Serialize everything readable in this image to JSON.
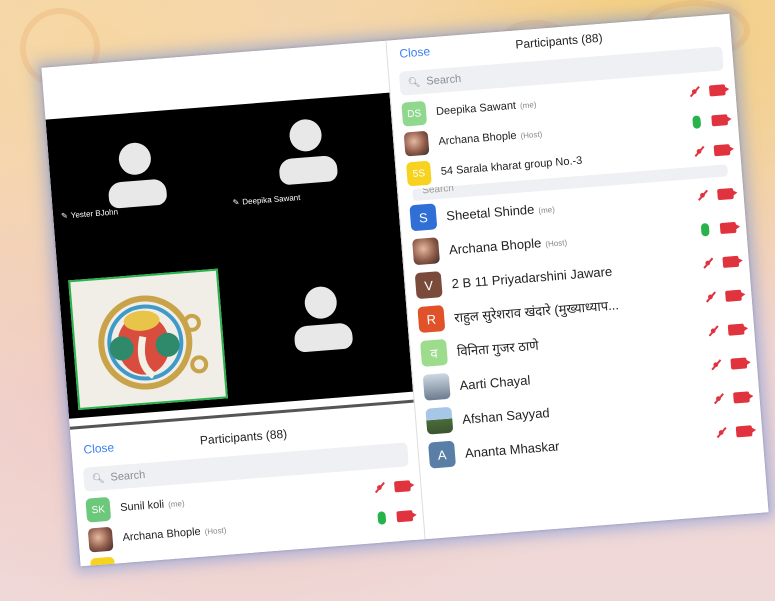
{
  "colors": {
    "accent_blue": "#3b82f6",
    "mic_off_red": "#e0333d",
    "mic_on_green": "#27b34a",
    "video_bg": "#000000",
    "active_speaker": "#2bb24c"
  },
  "video": {
    "tiles": [
      {
        "name": "Yester BJohn",
        "type": "avatar"
      },
      {
        "name": "Deepika Sawant",
        "type": "avatar"
      },
      {
        "name": "",
        "type": "ganesha-image"
      },
      {
        "name": "",
        "type": "avatar"
      }
    ]
  },
  "left_panel": {
    "close_label": "Close",
    "title": "Participants (88)",
    "search_placeholder": "Search",
    "participants": [
      {
        "initials": "SK",
        "name": "Sunil koli",
        "tag": "(me)",
        "badge_color": "#6cc87a",
        "mic": "off"
      },
      {
        "initials": "",
        "name": "Archana Bhople",
        "tag": "(Host)",
        "badge_color": "photo",
        "mic": "on"
      },
      {
        "initials": "5S",
        "name": "54 Sarala kharat group No.-3",
        "tag": "",
        "badge_color": "#f7d21f",
        "mic": "off"
      }
    ]
  },
  "right_panel": {
    "close_label": "Close",
    "title": "Participants (88)",
    "search_placeholder": "Search",
    "sub_search": "Search",
    "top_participants": [
      {
        "initials": "DS",
        "name": "Deepika Sawant",
        "tag": "(me)",
        "badge_color": "#8fd88e",
        "mic": "off"
      },
      {
        "initials": "",
        "name": "Archana Bhople",
        "tag": "(Host)",
        "badge_color": "photo",
        "mic": "on"
      },
      {
        "initials": "5S",
        "name": "54 Sarala kharat group No.-3",
        "tag": "",
        "badge_color": "#f7d21f",
        "mic": "off"
      }
    ],
    "participants": [
      {
        "initials": "S",
        "name": "Sheetal Shinde",
        "tag": "(me)",
        "badge_color": "#2f6fd6",
        "mic": "off"
      },
      {
        "initials": "",
        "name": "Archana Bhople",
        "tag": "(Host)",
        "badge_color": "photo",
        "mic": "on"
      },
      {
        "initials": "V",
        "name": "2 B 11 Priyadarshini Jaware",
        "tag": "",
        "badge_color": "#7a4a3a",
        "mic": "off"
      },
      {
        "initials": "R",
        "name": "राहुल सुरेशराव खंदारे (मुख्याध्याप...",
        "tag": "",
        "badge_color": "#e0522a",
        "mic": "off"
      },
      {
        "initials": "व",
        "name": "विनिता गुजर ठाणे",
        "tag": "",
        "badge_color": "#9ddc8c",
        "mic": "off"
      },
      {
        "initials": "",
        "name": "Aarti Chayal",
        "tag": "",
        "badge_color": "photo",
        "mic": "off"
      },
      {
        "initials": "",
        "name": "Afshan Sayyad",
        "tag": "",
        "badge_color": "photo-landscape",
        "mic": "off"
      },
      {
        "initials": "A",
        "name": "Ananta Mhaskar",
        "tag": "",
        "badge_color": "#5a7fa6",
        "mic": "off"
      }
    ]
  }
}
